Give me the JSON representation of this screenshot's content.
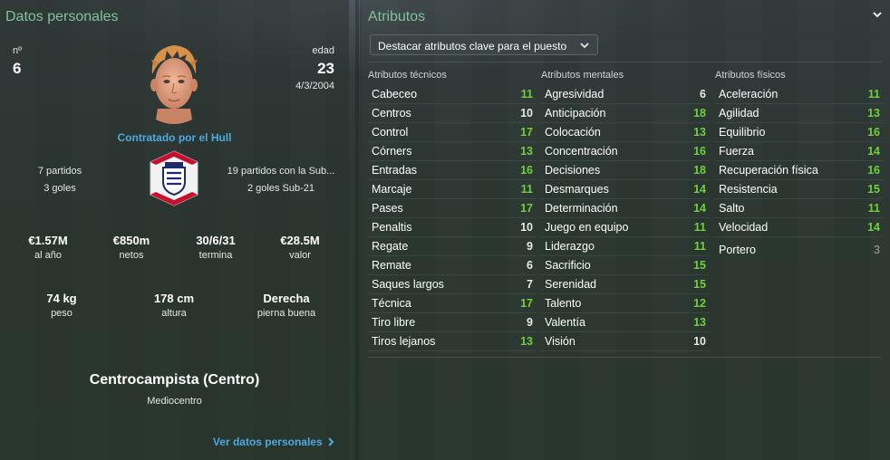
{
  "personal": {
    "title": "Datos personales",
    "number_label": "nº",
    "number": "6",
    "age_label": "edad",
    "age": "23",
    "dob": "4/3/2004",
    "signed_text": "Contratado por el Hull",
    "caps_left": [
      "7 partidos",
      "3 goles"
    ],
    "caps_right": [
      "19 partidos con la Sub...",
      "2 goles Sub-21"
    ],
    "stats_row1": [
      {
        "value": "€1.57M",
        "label": "al año"
      },
      {
        "value": "€850m",
        "label": "netos"
      },
      {
        "value": "30/6/31",
        "label": "termina"
      },
      {
        "value": "€28.5M",
        "label": "valor"
      }
    ],
    "stats_row2": [
      {
        "value": "74 kg",
        "label": "peso"
      },
      {
        "value": "178 cm",
        "label": "altura"
      },
      {
        "value": "Derecha",
        "label": "pierna buena"
      }
    ],
    "position_main": "Centrocampista (Centro)",
    "position_sub": "Mediocentro",
    "link_label": "Ver datos personales"
  },
  "attributes": {
    "title": "Atributos",
    "dropdown_label": "Destacar atributos clave para el puesto",
    "colors": {
      "key": "#6fd13a",
      "normal": "#e8e8e8",
      "goalkeeper": "#9aa0a0"
    },
    "technical": {
      "header": "Atributos técnicos",
      "items": [
        {
          "name": "Cabeceo",
          "value": "11",
          "key": true
        },
        {
          "name": "Centros",
          "value": "10",
          "key": false
        },
        {
          "name": "Control",
          "value": "17",
          "key": true
        },
        {
          "name": "Córners",
          "value": "13",
          "key": true
        },
        {
          "name": "Entradas",
          "value": "16",
          "key": true
        },
        {
          "name": "Marcaje",
          "value": "11",
          "key": true
        },
        {
          "name": "Pases",
          "value": "17",
          "key": true
        },
        {
          "name": "Penaltis",
          "value": "10",
          "key": false
        },
        {
          "name": "Regate",
          "value": "9",
          "key": false
        },
        {
          "name": "Remate",
          "value": "6",
          "key": false
        },
        {
          "name": "Saques largos",
          "value": "7",
          "key": false
        },
        {
          "name": "Técnica",
          "value": "17",
          "key": true
        },
        {
          "name": "Tiro libre",
          "value": "9",
          "key": false
        },
        {
          "name": "Tiros lejanos",
          "value": "13",
          "key": true
        }
      ]
    },
    "mental": {
      "header": "Atributos mentales",
      "items": [
        {
          "name": "Agresividad",
          "value": "6",
          "key": false
        },
        {
          "name": "Anticipación",
          "value": "18",
          "key": true
        },
        {
          "name": "Colocación",
          "value": "13",
          "key": true
        },
        {
          "name": "Concentración",
          "value": "16",
          "key": true
        },
        {
          "name": "Decisiones",
          "value": "18",
          "key": true
        },
        {
          "name": "Desmarques",
          "value": "14",
          "key": true
        },
        {
          "name": "Determinación",
          "value": "14",
          "key": true
        },
        {
          "name": "Juego en equipo",
          "value": "11",
          "key": true
        },
        {
          "name": "Liderazgo",
          "value": "11",
          "key": true
        },
        {
          "name": "Sacrificio",
          "value": "15",
          "key": true
        },
        {
          "name": "Serenidad",
          "value": "15",
          "key": true
        },
        {
          "name": "Talento",
          "value": "12",
          "key": true
        },
        {
          "name": "Valentía",
          "value": "13",
          "key": true
        },
        {
          "name": "Visión",
          "value": "10",
          "key": false
        }
      ]
    },
    "physical": {
      "header": "Atributos físicos",
      "items": [
        {
          "name": "Aceleración",
          "value": "11",
          "key": true
        },
        {
          "name": "Agilidad",
          "value": "13",
          "key": true
        },
        {
          "name": "Equilibrio",
          "value": "16",
          "key": true
        },
        {
          "name": "Fuerza",
          "value": "14",
          "key": true
        },
        {
          "name": "Recuperación física",
          "value": "16",
          "key": true
        },
        {
          "name": "Resistencia",
          "value": "15",
          "key": true
        },
        {
          "name": "Salto",
          "value": "11",
          "key": true
        },
        {
          "name": "Velocidad",
          "value": "14",
          "key": true
        }
      ],
      "goalkeeper": {
        "name": "Portero",
        "value": "3"
      }
    }
  }
}
